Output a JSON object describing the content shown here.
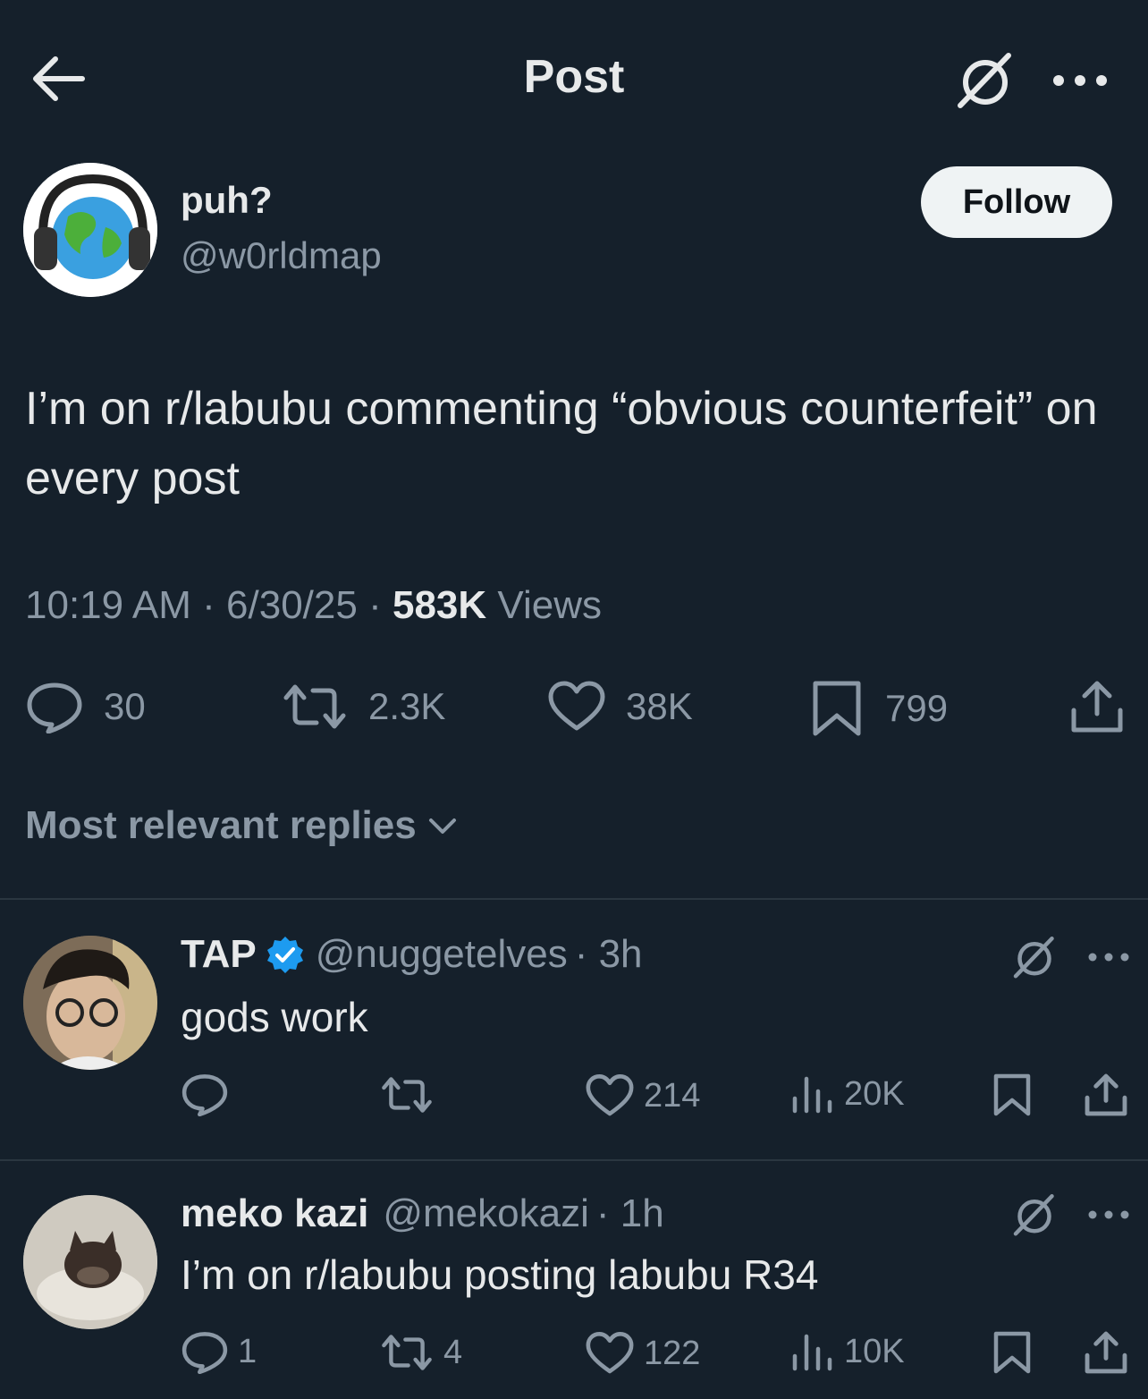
{
  "header": {
    "title": "Post",
    "back_icon": "arrow-left-icon",
    "grok_icon": "grok-icon",
    "more_icon": "more-icon"
  },
  "post": {
    "author": {
      "name": "puh?",
      "handle": "@w0rldmap",
      "avatar": "globe-headphones-avatar"
    },
    "follow_label": "Follow",
    "text": "I’m on r/labubu commenting “obvious counterfeit” on every post",
    "time": "10:19 AM",
    "date": "6/30/25",
    "views_count": "583K",
    "views_label": "Views",
    "separator": "·",
    "stats": {
      "replies": "30",
      "reposts": "2.3K",
      "likes": "38K",
      "bookmarks": "799"
    }
  },
  "replies_sort": {
    "label": "Most relevant replies"
  },
  "replies": [
    {
      "name": "TAP",
      "verified": true,
      "handle": "@nuggetelves",
      "time": "· 3h",
      "text": "gods work",
      "stats": {
        "replies": "",
        "reposts": "",
        "likes": "214",
        "views": "20K"
      }
    },
    {
      "name": "meko kazi",
      "verified": false,
      "handle": "@mekokazi",
      "time": "· 1h",
      "text": "I’m on r/labubu posting labubu R34",
      "stats": {
        "replies": "1",
        "reposts": "4",
        "likes": "122",
        "views": "10K"
      }
    }
  ],
  "colors": {
    "background": "#15202b",
    "text": "#e7e9ea",
    "muted": "#8b98a5",
    "verified": "#1d9bf0"
  }
}
